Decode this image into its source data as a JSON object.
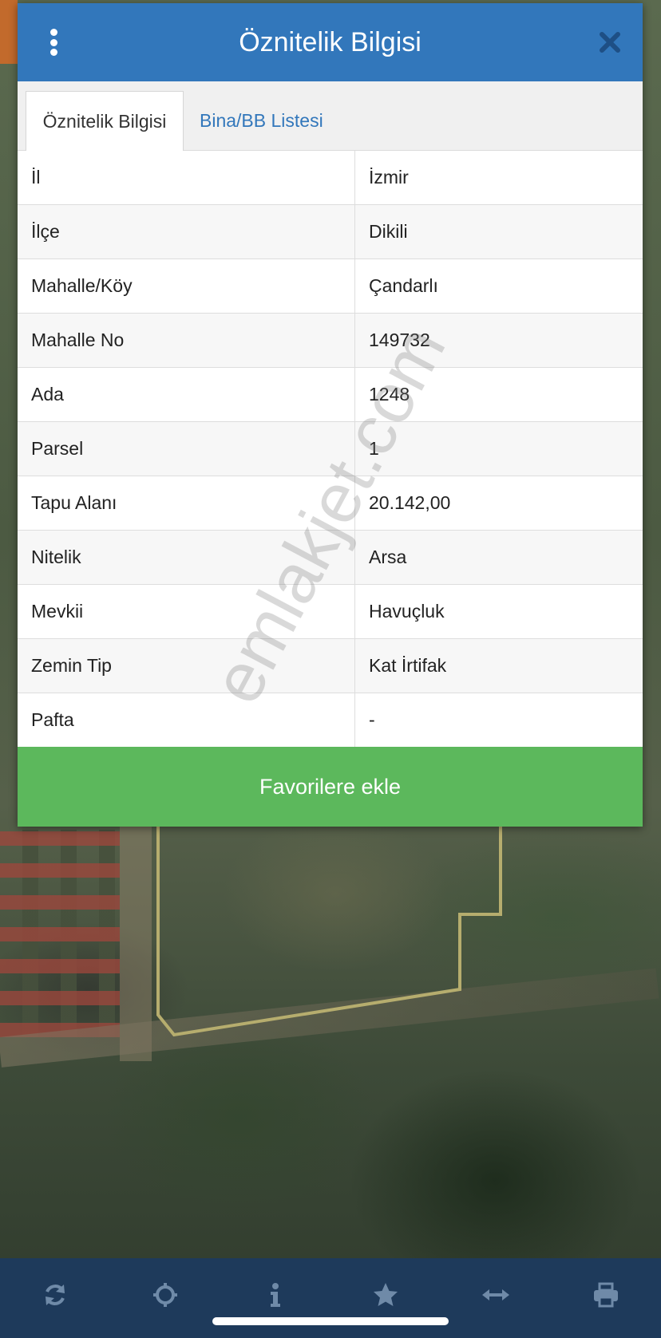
{
  "modal": {
    "title": "Öznitelik Bilgisi",
    "tabs": [
      {
        "label": "Öznitelik Bilgisi",
        "active": true
      },
      {
        "label": "Bina/BB Listesi",
        "active": false
      }
    ],
    "rows": [
      {
        "key": "İl",
        "value": "İzmir"
      },
      {
        "key": "İlçe",
        "value": "Dikili"
      },
      {
        "key": "Mahalle/Köy",
        "value": "Çandarlı"
      },
      {
        "key": "Mahalle No",
        "value": "149732"
      },
      {
        "key": "Ada",
        "value": "1248"
      },
      {
        "key": "Parsel",
        "value": "1"
      },
      {
        "key": "Tapu Alanı",
        "value": "20.142,00"
      },
      {
        "key": "Nitelik",
        "value": "Arsa"
      },
      {
        "key": "Mevkii",
        "value": "Havuçluk"
      },
      {
        "key": "Zemin Tip",
        "value": "Kat İrtifak"
      },
      {
        "key": "Pafta",
        "value": "-"
      }
    ],
    "favorite_button": "Favorilere ekle"
  },
  "watermark": "emlakjet.com",
  "toolbar": {
    "icons": [
      "refresh-icon",
      "locate-icon",
      "info-icon",
      "star-icon",
      "measure-icon",
      "print-icon"
    ]
  },
  "colors": {
    "header": "#3277bb",
    "tab_link": "#3277bb",
    "favorite_button": "#5cb85c",
    "toolbar": "#1e3a5b"
  }
}
